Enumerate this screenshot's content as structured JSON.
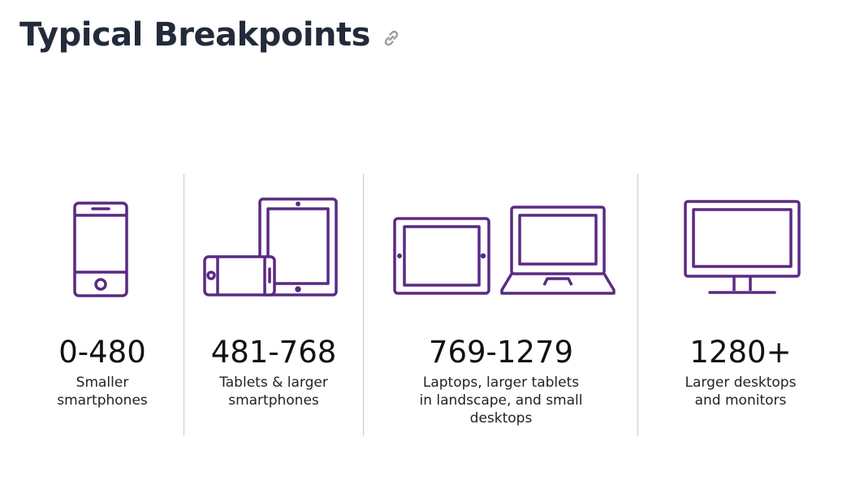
{
  "page": {
    "title": "Typical Breakpoints"
  },
  "icons": {
    "link": "link-icon",
    "accent_color": "#5a2a83"
  },
  "breakpoints": [
    {
      "range": "0-480",
      "description_lines": [
        "Smaller",
        "smartphones"
      ]
    },
    {
      "range": "481-768",
      "description_lines": [
        "Tablets & larger",
        "smartphones"
      ]
    },
    {
      "range": "769-1279",
      "description_lines": [
        "Laptops, larger tablets",
        "in landscape, and small",
        "desktops"
      ]
    },
    {
      "range": "1280+",
      "description_lines": [
        "Larger desktops",
        "and monitors"
      ]
    }
  ]
}
